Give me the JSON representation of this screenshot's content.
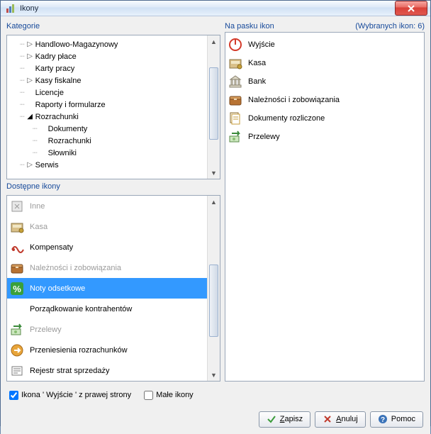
{
  "window": {
    "title": "Ikony"
  },
  "labels": {
    "categories": "Kategorie",
    "available": "Dostępne ikony",
    "toolbar": "Na pasku ikon",
    "selected_count_prefix": "(Wybranych ikon: ",
    "selected_count": "6",
    "selected_count_suffix": ")"
  },
  "categories": [
    {
      "label": "Handlowo-Magazynowy",
      "level": 1,
      "expandable": true,
      "expanded": false
    },
    {
      "label": "Kadry płace",
      "level": 1,
      "expandable": true,
      "expanded": false
    },
    {
      "label": "Karty pracy",
      "level": 1,
      "expandable": false
    },
    {
      "label": "Kasy fiskalne",
      "level": 1,
      "expandable": true,
      "expanded": false
    },
    {
      "label": "Licencje",
      "level": 1,
      "expandable": false
    },
    {
      "label": "Raporty i formularze",
      "level": 1,
      "expandable": false
    },
    {
      "label": "Rozrachunki",
      "level": 1,
      "expandable": true,
      "expanded": true
    },
    {
      "label": "Dokumenty",
      "level": 2,
      "expandable": false
    },
    {
      "label": "Rozrachunki",
      "level": 2,
      "expandable": false
    },
    {
      "label": "Słowniki",
      "level": 2,
      "expandable": false
    },
    {
      "label": "Serwis",
      "level": 1,
      "expandable": true,
      "expanded": false
    }
  ],
  "available": [
    {
      "label": "Inne",
      "icon": "misc",
      "disabled": true
    },
    {
      "label": "Kasa",
      "icon": "cash",
      "disabled": true
    },
    {
      "label": "Kompensaty",
      "icon": "compensate",
      "disabled": false
    },
    {
      "label": "Należności i zobowiązania",
      "icon": "receivables",
      "disabled": true
    },
    {
      "label": "Noty odsetkowe",
      "icon": "percent",
      "selected": true
    },
    {
      "label": "Porządkowanie kontrahentów",
      "icon": "none",
      "disabled": false
    },
    {
      "label": "Przelewy",
      "icon": "transfer",
      "disabled": true
    },
    {
      "label": "Przeniesienia rozrachunków",
      "icon": "move",
      "disabled": false
    },
    {
      "label": "Rejestr strat sprzedaży",
      "icon": "register",
      "disabled": false
    }
  ],
  "selected": [
    {
      "label": "Wyjście",
      "icon": "power"
    },
    {
      "label": "Kasa",
      "icon": "cash"
    },
    {
      "label": "Bank",
      "icon": "bank"
    },
    {
      "label": "Należności i zobowiązania",
      "icon": "receivables"
    },
    {
      "label": "Dokumenty rozliczone",
      "icon": "docs"
    },
    {
      "label": "Przelewy",
      "icon": "transfer"
    }
  ],
  "options": {
    "exit_right": {
      "label": "Ikona ' Wyjście ' z prawej strony",
      "checked": true
    },
    "small_icons": {
      "label": "Małe ikony",
      "checked": false
    }
  },
  "buttons": {
    "save": "Zapisz",
    "cancel": "Anuluj",
    "help": "Pomoc"
  }
}
